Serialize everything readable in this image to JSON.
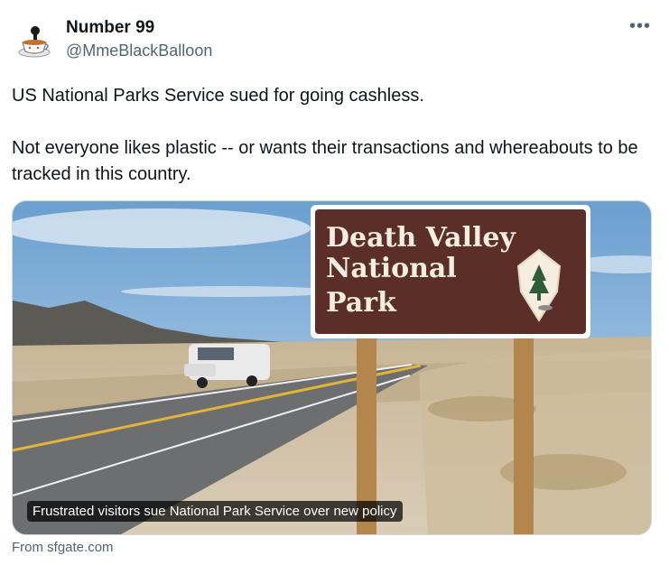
{
  "author": {
    "display_name": "Number 99",
    "handle": "@MmeBlackBalloon",
    "avatar_icon": "teacup-avatar-icon"
  },
  "more_icon": "more-options-icon",
  "tweet": {
    "line1": "US National Parks Service sued for going cashless.",
    "line2": "Not everyone likes plastic -- or wants their transactions and whereabouts to be tracked in this country."
  },
  "card": {
    "sign": {
      "line1": "Death Valley",
      "line2": "National",
      "line3": "Park"
    },
    "caption": "Frustrated visitors sue National Park Service over new policy",
    "source": "From sfgate.com"
  },
  "colors": {
    "sign_brown": "#5b2f27",
    "sky": "#8fb8dc",
    "text_secondary": "#536471"
  }
}
